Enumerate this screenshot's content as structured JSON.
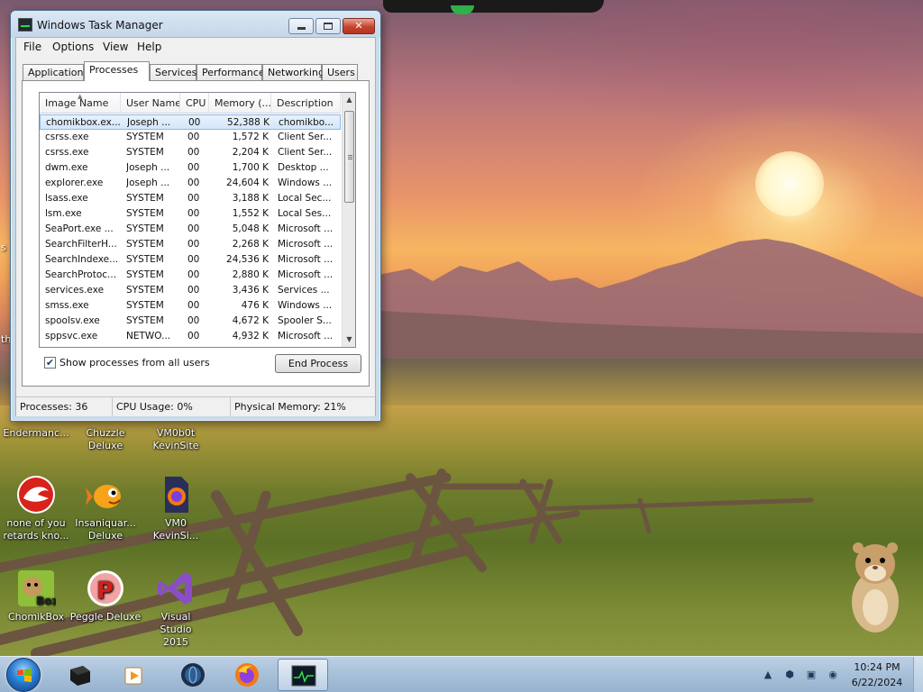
{
  "window": {
    "title": "Windows Task Manager",
    "menu": [
      "File",
      "Options",
      "View",
      "Help"
    ],
    "tabs": [
      "Applications",
      "Processes",
      "Services",
      "Performance",
      "Networking",
      "Users"
    ],
    "active_tab": "Processes"
  },
  "process_list": {
    "columns": [
      "Image Name",
      "User Name",
      "CPU",
      "Memory (...",
      "Description"
    ],
    "rows": [
      {
        "image": "chomikbox.ex...",
        "user": "Joseph ...",
        "cpu": "00",
        "memory": "52,388 K",
        "description": "chomikbo..."
      },
      {
        "image": "csrss.exe",
        "user": "SYSTEM",
        "cpu": "00",
        "memory": "1,572 K",
        "description": "Client Ser..."
      },
      {
        "image": "csrss.exe",
        "user": "SYSTEM",
        "cpu": "00",
        "memory": "2,204 K",
        "description": "Client Ser..."
      },
      {
        "image": "dwm.exe",
        "user": "Joseph ...",
        "cpu": "00",
        "memory": "1,700 K",
        "description": "Desktop ..."
      },
      {
        "image": "explorer.exe",
        "user": "Joseph ...",
        "cpu": "00",
        "memory": "24,604 K",
        "description": "Windows ..."
      },
      {
        "image": "lsass.exe",
        "user": "SYSTEM",
        "cpu": "00",
        "memory": "3,188 K",
        "description": "Local Sec..."
      },
      {
        "image": "lsm.exe",
        "user": "SYSTEM",
        "cpu": "00",
        "memory": "1,552 K",
        "description": "Local Ses..."
      },
      {
        "image": "SeaPort.exe ...",
        "user": "SYSTEM",
        "cpu": "00",
        "memory": "5,048 K",
        "description": "Microsoft ..."
      },
      {
        "image": "SearchFilterH...",
        "user": "SYSTEM",
        "cpu": "00",
        "memory": "2,268 K",
        "description": "Microsoft ..."
      },
      {
        "image": "SearchIndexe...",
        "user": "SYSTEM",
        "cpu": "00",
        "memory": "24,536 K",
        "description": "Microsoft ..."
      },
      {
        "image": "SearchProtoc...",
        "user": "SYSTEM",
        "cpu": "00",
        "memory": "2,880 K",
        "description": "Microsoft ..."
      },
      {
        "image": "services.exe",
        "user": "SYSTEM",
        "cpu": "00",
        "memory": "3,436 K",
        "description": "Services ..."
      },
      {
        "image": "smss.exe",
        "user": "SYSTEM",
        "cpu": "00",
        "memory": "476 K",
        "description": "Windows ..."
      },
      {
        "image": "spoolsv.exe",
        "user": "SYSTEM",
        "cpu": "00",
        "memory": "4,672 K",
        "description": "Spooler S..."
      },
      {
        "image": "sppsvc.exe",
        "user": "NETWO...",
        "cpu": "00",
        "memory": "4,932 K",
        "description": "Microsoft ..."
      }
    ],
    "selected_row": 0
  },
  "controls": {
    "show_all_label": "Show processes from all users",
    "show_all_checked": true,
    "end_process_label": "End Process"
  },
  "status": {
    "processes": "Processes: 36",
    "cpu": "CPU Usage: 0%",
    "memory": "Physical Memory: 21%"
  },
  "desktop_icons": [
    {
      "name": "endermanch",
      "label": "Endermanc..."
    },
    {
      "name": "chuzzle",
      "label": "Chuzzle Deluxe"
    },
    {
      "name": "vm0b0t",
      "label": "VM0b0t KevinSite"
    },
    {
      "name": "none-of-you",
      "label": "none of you retards kno..."
    },
    {
      "name": "insaniquarium",
      "label": "Insaniquar... Deluxe"
    },
    {
      "name": "vm0",
      "label": "VM0 KevinSi..."
    },
    {
      "name": "chomikbox",
      "label": "ChomikBox"
    },
    {
      "name": "peggle",
      "label": "Peggle Deluxe"
    },
    {
      "name": "visual-studio",
      "label": "Visual Studio 2015"
    }
  ],
  "edge_labels": {
    "s": "s",
    "th": "th"
  },
  "taskbar": {
    "apps": [
      "terminal-app",
      "media-player",
      "globe-app",
      "firefox",
      "task-manager"
    ],
    "clock_time": "10:24 PM",
    "clock_date": "6/22/2024"
  },
  "colors": {
    "selection": "#d3e6f9",
    "title_bar": "#c4d6e8",
    "close_button": "#c6442d",
    "taskbar": "#a9c1da"
  }
}
